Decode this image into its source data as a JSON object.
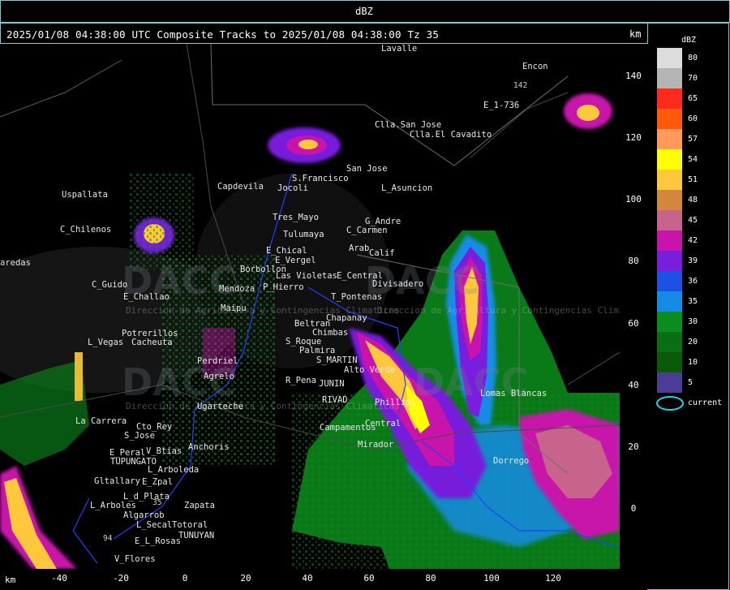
{
  "top_title": "dBZ",
  "header": {
    "text": "2025/01/08 04:38:00 UTC Composite Tracks to 2025/01/08 04:38:00 Tz 35",
    "unit": "km"
  },
  "y_axis": {
    "ticks": [
      "140",
      "120",
      "100",
      "80",
      "60",
      "40",
      "20",
      "0"
    ]
  },
  "x_axis": {
    "unit": "km",
    "ticks": [
      "-40",
      "-20",
      "0",
      "20",
      "40",
      "60",
      "80",
      "100",
      "120"
    ]
  },
  "legend": {
    "title": "dBZ",
    "entries": [
      {
        "label": "80",
        "color": "#dcdcdc"
      },
      {
        "label": "70",
        "color": "#b4b4b4"
      },
      {
        "label": "65",
        "color": "#ff2a1e"
      },
      {
        "label": "60",
        "color": "#ff5a0a"
      },
      {
        "label": "57",
        "color": "#ff9a5a"
      },
      {
        "label": "54",
        "color": "#ffff00"
      },
      {
        "label": "51",
        "color": "#ffc83c"
      },
      {
        "label": "48",
        "color": "#d2873c"
      },
      {
        "label": "45",
        "color": "#c8648c"
      },
      {
        "label": "42",
        "color": "#c814aa"
      },
      {
        "label": "39",
        "color": "#781edc"
      },
      {
        "label": "36",
        "color": "#1e50e6"
      },
      {
        "label": "35",
        "color": "#148ce6"
      },
      {
        "label": "30",
        "color": "#0a8c1e"
      },
      {
        "label": "20",
        "color": "#0a6e14"
      },
      {
        "label": "10",
        "color": "#0a5a0a"
      },
      {
        "label": "5",
        "color": "#4b3c96"
      }
    ],
    "current_label": "current",
    "current_color": "#19d9e8"
  },
  "places": [
    "Encon",
    "E_1-736",
    "Clla.San Jose",
    "Clla.El Cavadito",
    "San Jose",
    "S.Francisco",
    "Jocoli",
    "L_Asuncion",
    "Uspallata",
    "Capdevila",
    "Tres_Mayo",
    "Tulumaya",
    "G_Andre",
    "C_Carmen",
    "C_Chilenos",
    "E_Chical",
    "E_Vergel",
    "Arab",
    "Calif",
    "Borbollon",
    "P_Hierro",
    "E_Central",
    "Divisadero",
    "C_Guido",
    "E_Challao",
    "Las Violetas",
    "T_Pontenas",
    "Chapanay",
    "Alto Verde",
    "Potrerillos",
    "Cacheuta",
    "L_Vegas",
    "Perdriel",
    "Agrelo",
    "Beltran",
    "Chimbas",
    "S_Roque",
    "Palmira",
    "S_MARTIN",
    "R_Pena",
    "JUNIN",
    "RIVAD",
    "Phillips",
    "Lomas Blancas",
    "La Carrera",
    "Ugarteche",
    "Campamentos",
    "Central",
    "Cto_Rey",
    "S_Jose",
    "E_Peral",
    "V_Btias",
    "TUPUNGATO",
    "Anchoris",
    "Mirador",
    "L_Arboleda",
    "Gltallary",
    "E_Zpal",
    "L_d_Plata",
    "Zapata",
    "L_Arboles",
    "Algarrob",
    "L_Secal",
    "Totoral",
    "E_L_Rosas",
    "TUNUYAN",
    "V_Flores",
    "Dorrego",
    "Maipu",
    "Mendoza",
    "aredas",
    "Lavalle"
  ],
  "roads": [
    "142",
    "35",
    "94"
  ],
  "watermark": {
    "brand": "DACC",
    "caption": "Direccion de Agricultura y Contingencias Climaticas"
  }
}
